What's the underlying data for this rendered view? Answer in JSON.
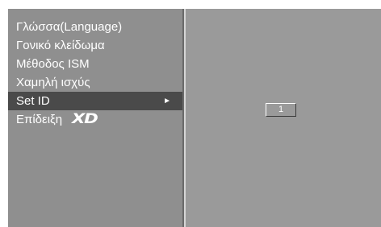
{
  "menu": {
    "items": [
      {
        "label": "Γλώσσα(Language)"
      },
      {
        "label": "Γονικό κλείδωμα"
      },
      {
        "label": "Μέθοδος ISM"
      },
      {
        "label": "Χαμηλή ισχύς"
      },
      {
        "label": "Set ID",
        "selected": true,
        "arrow": "►"
      },
      {
        "label": "Επίδειξη",
        "logo": "XD"
      }
    ]
  },
  "set_id": {
    "value": "1"
  }
}
